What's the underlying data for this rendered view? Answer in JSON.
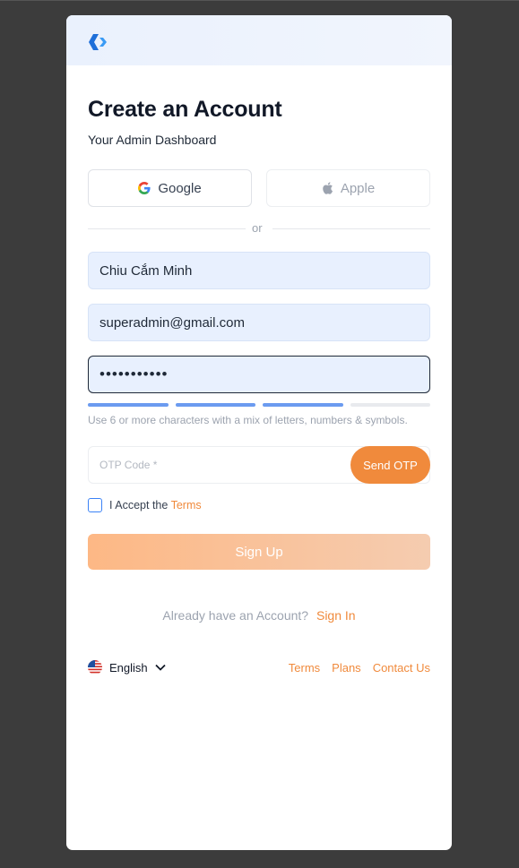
{
  "page": {
    "title": "Create an Account",
    "subtitle": "Your Admin Dashboard"
  },
  "social": {
    "google_label": "Google",
    "apple_label": "Apple"
  },
  "divider": {
    "text": "or"
  },
  "form": {
    "name_value": "Chiu Cắm Minh",
    "email_value": "superadmin@gmail.com",
    "password_value": "•••••••••••",
    "password_strength_filled_segments": 3,
    "password_strength_total_segments": 4,
    "password_hint": "Use 6 or more characters with a mix of letters, numbers & symbols.",
    "otp_placeholder": "OTP Code *",
    "send_otp_label": "Send OTP",
    "accept_prefix": "I Accept the",
    "accept_terms_link": "Terms",
    "signup_label": "Sign Up"
  },
  "signin": {
    "prompt": "Already have an Account?",
    "link": "Sign In"
  },
  "footer": {
    "language": "English",
    "links": [
      "Terms",
      "Plans",
      "Contact Us"
    ]
  },
  "colors": {
    "accent": "#f08a3c",
    "input_bg": "#e8f0fe",
    "meter_active": "#6b9bf0",
    "meter_inactive": "#e8eaee",
    "logo_blue": "#1f7ae0"
  },
  "icons": {
    "logo": "brand-logo-icon",
    "google": "google-icon",
    "apple": "apple-icon",
    "flag": "us-flag-icon",
    "chevron": "chevron-down-icon"
  }
}
